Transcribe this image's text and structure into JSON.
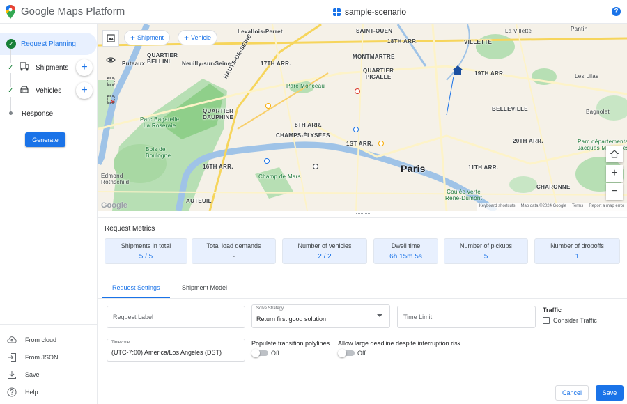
{
  "header": {
    "app_title": "Google Maps Platform",
    "scenario_name": "sample-scenario",
    "help_icon": "help-icon"
  },
  "sidebar": {
    "steps": [
      {
        "label": "Request Planning",
        "state": "active",
        "icon": "check-circle-icon"
      },
      {
        "label": "Shipments",
        "state": "done",
        "icon": "shipment-icon",
        "add": "+"
      },
      {
        "label": "Vehicles",
        "state": "done",
        "icon": "vehicle-icon",
        "add": "+"
      },
      {
        "label": "Response",
        "state": "pending"
      }
    ],
    "generate_label": "Generate",
    "bottom_items": [
      {
        "label": "From cloud",
        "icon": "cloud-upload-icon"
      },
      {
        "label": "From JSON",
        "icon": "import-icon"
      },
      {
        "label": "Save",
        "icon": "download-icon"
      },
      {
        "label": "Help",
        "icon": "help-outline-icon"
      }
    ]
  },
  "map": {
    "add_shipment_label": "Shipment",
    "add_vehicle_label": "Vehicle",
    "labels": {
      "levallois": "Levallois-Perret",
      "saint_ouen": "SAINT-OUEN",
      "quartier_bellini": "QUARTIER\nBELLINI",
      "puteaux": "Puteaux",
      "neuilly": "Neuilly-sur-Seine",
      "hauts_de_seine": "HAUTS-DE-SEINE",
      "arr17": "17TH ARR.",
      "arr18": "18TH ARR.",
      "montmartre": "MONTMARTRE",
      "pigalle": "QUARTIER\nPIGALLE",
      "villette": "VILLETTE",
      "la_villette": "La Villette",
      "pantin": "Pantin",
      "arr19": "19TH ARR.",
      "les_lilas": "Les Lilas",
      "parc_monceau": "Parc Monceau",
      "quartier_dauphine": "QUARTIER\nDAUPHINE",
      "parc_bagatelle": "Parc Bagatelle\nLa Roseraie",
      "arr8": "8TH ARR.",
      "champs_elysees": "CHAMPS-ÉLYSÉES",
      "belleville": "BELLEVILLE",
      "bagnolet": "Bagnolet",
      "bois_boulogne": "Bois de\nBoulogne",
      "arr1": "1ST ARR.",
      "arr20": "20TH ARR.",
      "parc_dept": "Parc départemental\nJacques Moulin-les-Moulin",
      "arr16": "16TH ARR.",
      "paris": "Paris",
      "arr11": "11TH ARR.",
      "champ_de_mars": "Champ de Mars",
      "edmond": "Edmond\nRothschild",
      "auteuil": "AUTEUIL",
      "charonne": "CHARONNE",
      "coulee_verte": "Coulée verte\nRené-Dumont"
    },
    "attribution": {
      "shortcuts": "Keyboard shortcuts",
      "map_data": "Map data ©2024 Google",
      "terms": "Terms",
      "report": "Report a map error"
    },
    "google_mark": "Google"
  },
  "metrics": {
    "title": "Request Metrics",
    "cards": [
      {
        "label": "Shipments in total",
        "value": "5 / 5"
      },
      {
        "label": "Total load demands",
        "value": "-"
      },
      {
        "label": "Number of vehicles",
        "value": "2 / 2"
      },
      {
        "label": "Dwell time",
        "value": "6h 15m 5s"
      },
      {
        "label": "Number of pickups",
        "value": "5"
      },
      {
        "label": "Number of dropoffs",
        "value": "1"
      }
    ]
  },
  "tabs": [
    {
      "label": "Request Settings",
      "active": true
    },
    {
      "label": "Shipment Model",
      "active": false
    }
  ],
  "form": {
    "request_label_placeholder": "Request Label",
    "solve_strategy_label": "Solve Strategy",
    "solve_strategy_value": "Return first good solution",
    "time_limit_placeholder": "Time Limit",
    "traffic_title": "Traffic",
    "consider_traffic_label": "Consider Traffic",
    "consider_traffic_checked": false,
    "timezone_label": "Timezone",
    "timezone_value": "(UTC-7:00) America/Los Angeles (DST)",
    "polylines_title": "Populate transition polylines",
    "polylines_state": "Off",
    "deadline_title": "Allow large deadline despite interruption risk",
    "deadline_state": "Off"
  },
  "footer": {
    "cancel_label": "Cancel",
    "save_label": "Save"
  },
  "colors": {
    "accent": "#1a73e8",
    "success": "#188038",
    "metric_card_bg": "#e8f0fe"
  }
}
